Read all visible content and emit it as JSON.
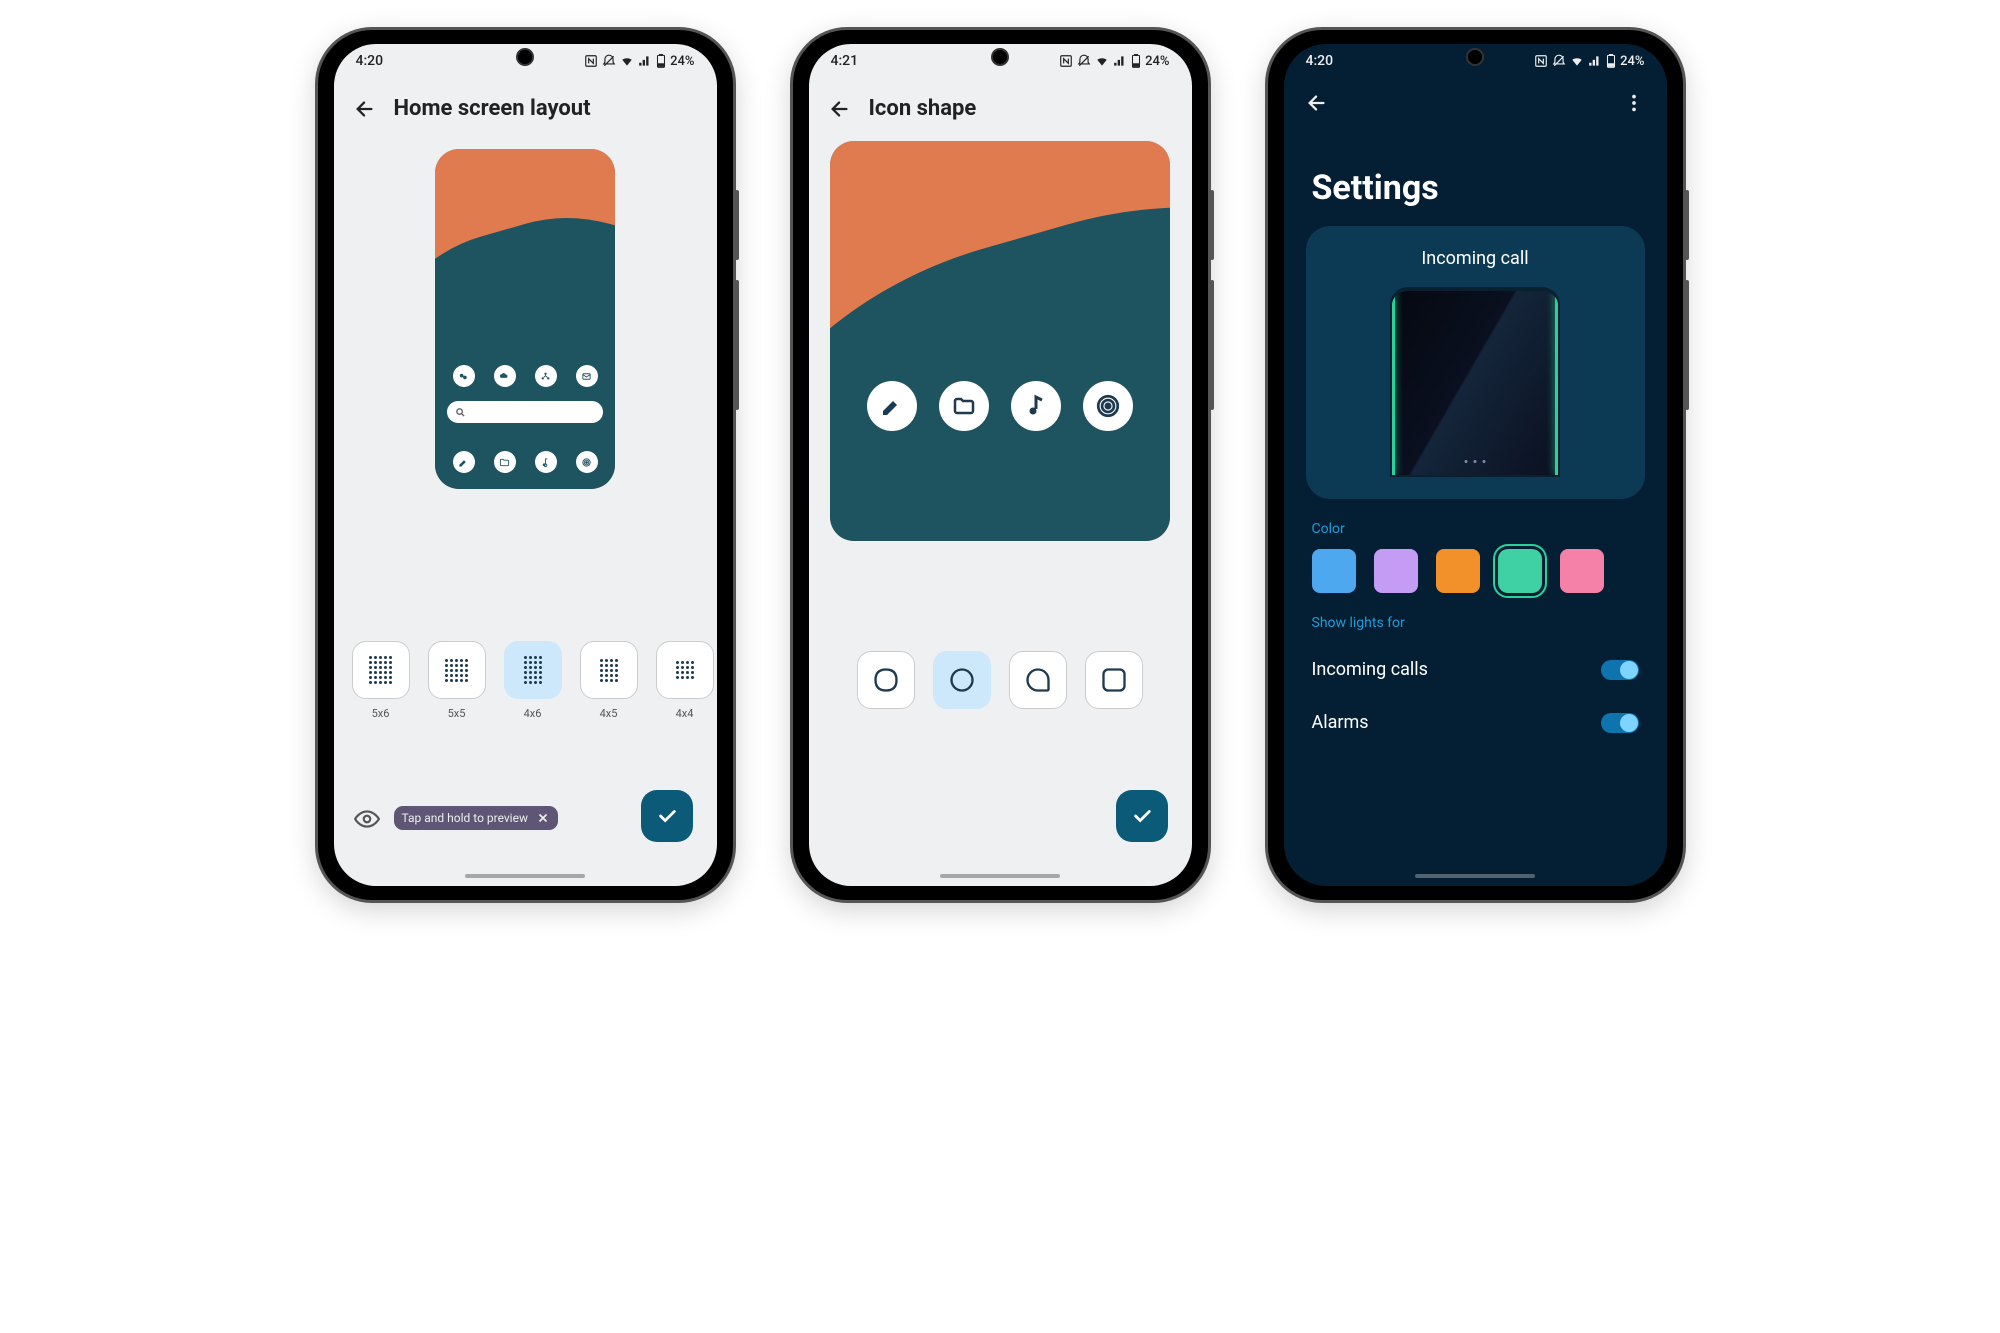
{
  "phone1": {
    "status": {
      "time": "4:20",
      "battery": "24%"
    },
    "title": "Home screen layout",
    "grid_options": [
      {
        "label": "5x6",
        "cols": 5,
        "rows": 6,
        "selected": false
      },
      {
        "label": "5x5",
        "cols": 5,
        "rows": 5,
        "selected": false
      },
      {
        "label": "4x6",
        "cols": 4,
        "rows": 6,
        "selected": true
      },
      {
        "label": "4x5",
        "cols": 4,
        "rows": 5,
        "selected": false
      },
      {
        "label": "4x4",
        "cols": 4,
        "rows": 4,
        "selected": false
      }
    ],
    "preview_toast": "Tap and hold to preview",
    "preview_app_icons": [
      "chat-icon",
      "cloud-icon",
      "share-icon",
      "mail-icon",
      "edit-icon",
      "folder-icon",
      "music-icon",
      "podcast-icon"
    ]
  },
  "phone2": {
    "status": {
      "time": "4:21",
      "battery": "24%"
    },
    "title": "Icon shape",
    "preview_icons": [
      "edit-icon",
      "folder-icon",
      "music-icon",
      "podcast-icon"
    ],
    "shapes": [
      {
        "name": "squircle",
        "selected": false
      },
      {
        "name": "circle",
        "selected": true
      },
      {
        "name": "teardrop",
        "selected": false
      },
      {
        "name": "rounded-square",
        "selected": false
      }
    ]
  },
  "phone3": {
    "title": "Settings",
    "card_title": "Incoming call",
    "color_section": "Color",
    "colors": [
      {
        "hex": "#4ea8ef",
        "selected": false
      },
      {
        "hex": "#c49cf4",
        "selected": false
      },
      {
        "hex": "#f2912a",
        "selected": false
      },
      {
        "hex": "#3fd1a3",
        "selected": true
      },
      {
        "hex": "#f581a8",
        "selected": false
      }
    ],
    "lights_section": "Show lights for",
    "toggles": [
      {
        "label": "Incoming calls",
        "on": true
      },
      {
        "label": "Alarms",
        "on": true
      }
    ]
  },
  "status_icons": [
    "nfc-icon",
    "alarm-off-icon",
    "wifi-icon",
    "signal-icon",
    "battery-icon"
  ]
}
